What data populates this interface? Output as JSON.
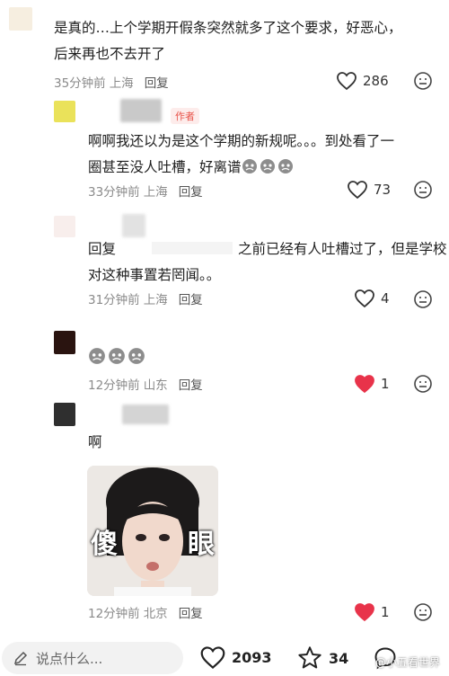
{
  "comments": [
    {
      "text_line1": "是真的…上个学期开假条突然就多了这个要求，好恶心，",
      "text_line2": "后来再也不去开了",
      "time": "35分钟前",
      "location": "上海",
      "reply_label": "回复",
      "likes": "286",
      "liked": false
    },
    {
      "author_badge": "作者",
      "text_line1": "啊啊我还以为是这个学期的新规呢。。。到处看了一",
      "text_line2": "圈甚至没人吐槽，好离谱",
      "time": "33分钟前",
      "location": "上海",
      "reply_label": "回复",
      "likes": "73",
      "liked": false
    },
    {
      "reply_prefix": "回复",
      "text_line1_tail": "之前已经有人吐槽过了，但是学校",
      "text_line2": "对这种事置若罔闻。。",
      "time": "31分钟前",
      "location": "上海",
      "reply_label": "回复",
      "likes": "4",
      "liked": false
    },
    {
      "time": "12分钟前",
      "location": "山东",
      "reply_label": "回复",
      "likes": "1",
      "liked": true
    },
    {
      "text_line1": "啊",
      "sticker_left": "傻",
      "sticker_right": "眼",
      "time": "12分钟前",
      "location": "北京",
      "reply_label": "回复",
      "likes": "1",
      "liked": true
    }
  ],
  "bottom_bar": {
    "placeholder": "说点什么...",
    "likes_count": "2093",
    "stars_count": "34",
    "watermark": "@小五看世界"
  },
  "colors": {
    "liked_red": "#e8334a",
    "meta_gray": "#8a8a8a",
    "author_badge": "#e8534a"
  }
}
